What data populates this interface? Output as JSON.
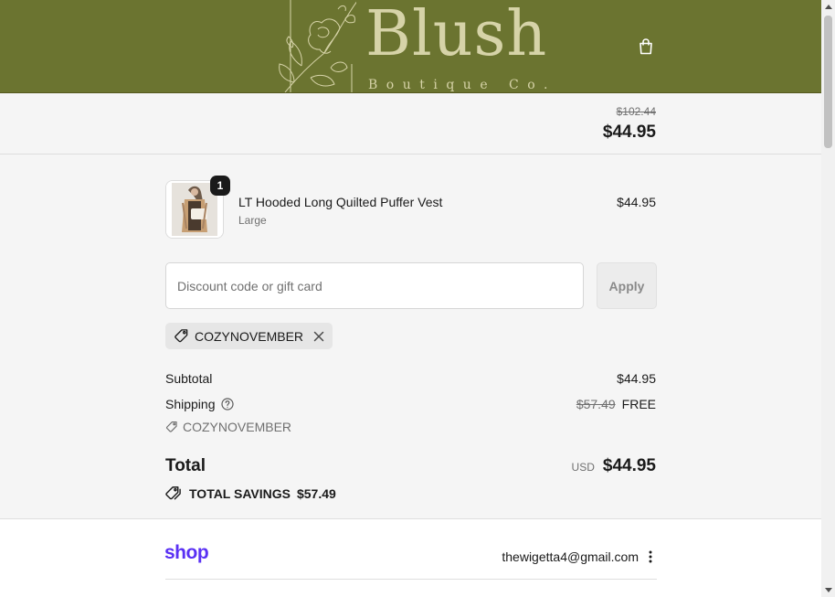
{
  "colors": {
    "header_bg": "#6b7430",
    "logo_color": "#d6d3a8",
    "shop_brand": "#5a31f4"
  },
  "header": {
    "logo_word": "Blush",
    "logo_sub": "Boutique Co.",
    "cart_icon": "shopping-bag-icon"
  },
  "summary": {
    "original_price": "$102.44",
    "total_price": "$44.95"
  },
  "item": {
    "name": "LT Hooded Long Quilted Puffer Vest",
    "variant": "Large",
    "price": "$44.95",
    "quantity": "1"
  },
  "discount": {
    "placeholder": "Discount code or gift card",
    "value": "",
    "apply_label": "Apply",
    "applied_code": "COZYNOVEMBER",
    "tag_icon": "tag-icon",
    "remove_icon": "close-icon"
  },
  "totals": {
    "subtotal_label": "Subtotal",
    "subtotal_value": "$44.95",
    "shipping_label": "Shipping",
    "shipping_original": "$57.49",
    "shipping_value": "FREE",
    "discount_line": "COZYNOVEMBER",
    "total_label": "Total",
    "currency": "USD",
    "total_value": "$44.95",
    "savings_label": "TOTAL SAVINGS",
    "savings_value": "$57.49"
  },
  "shop_pay": {
    "logo": "shop",
    "email": "thewigetta4@gmail.com"
  }
}
